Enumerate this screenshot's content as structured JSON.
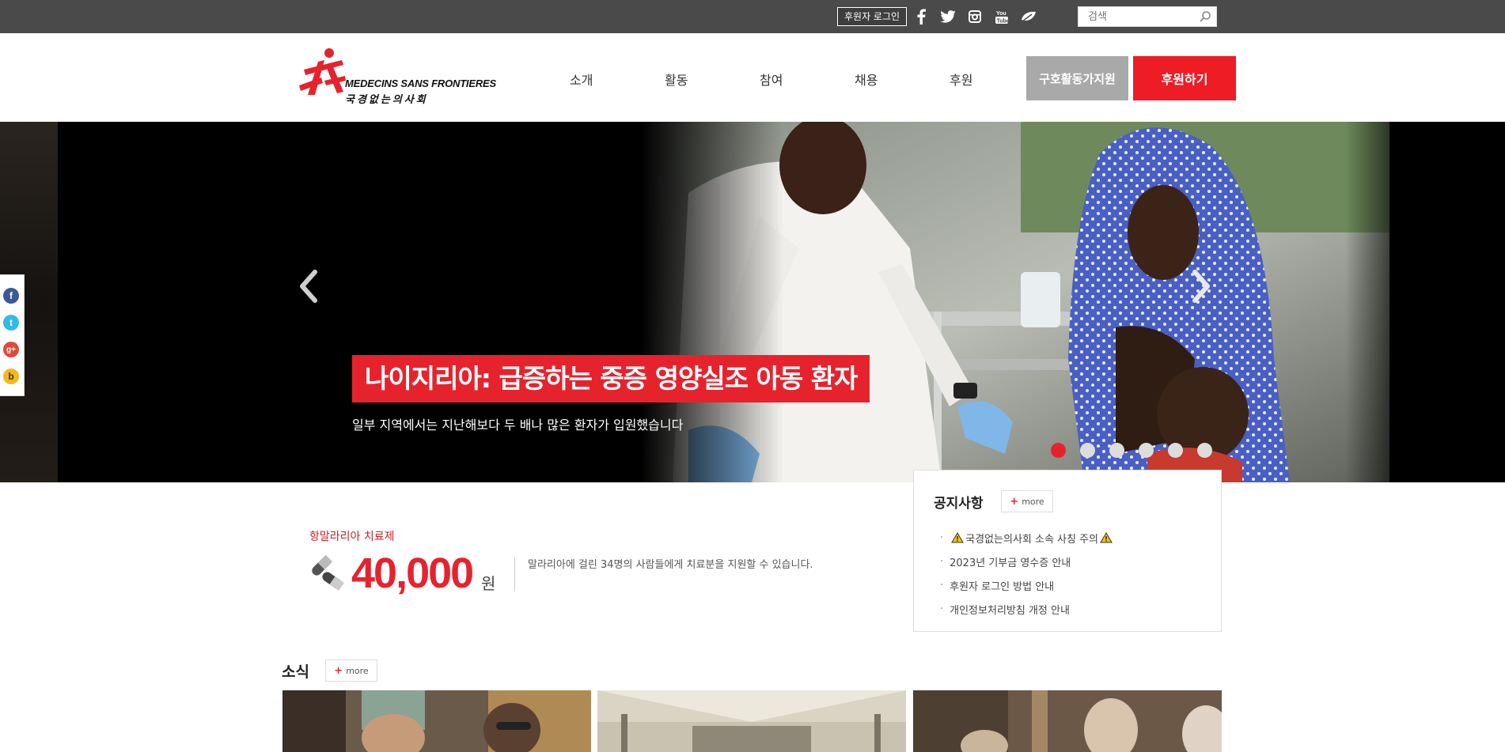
{
  "topbar": {
    "login_label": "후원자 로그인",
    "social": [
      "facebook-icon",
      "twitter-icon",
      "instagram-icon",
      "youtube-icon",
      "leaf-icon"
    ],
    "search_placeholder": "검색"
  },
  "header": {
    "logo_en": "MEDECINS SANS FRONTIERES",
    "logo_ko": "국경없는의사회",
    "nav": [
      "소개",
      "활동",
      "참여",
      "채용",
      "후원"
    ],
    "relief_button": "구호활동가지원",
    "donate_button": "후원하기"
  },
  "hero": {
    "title": "나이지리아: 급증하는 중증 영양실조 아동 환자",
    "subtitle": "일부 지역에서는 지난해보다 두 배나 많은 환자가 입원했습니다",
    "slide_count": 6,
    "active_slide": 1
  },
  "share_float": [
    "facebook",
    "twitter",
    "google-plus",
    "kakao"
  ],
  "notice": {
    "title": "공지사항",
    "more": "more",
    "items": [
      "국경없는의사회 소속 사칭 주의",
      "2023년 기부금 영수증 안내",
      "후원자 로그인 방법 안내",
      "개인정보처리방침 개정 안내"
    ]
  },
  "donation": {
    "label": "항말라리아 치료제",
    "amount": "40,000",
    "unit": "원",
    "description": "말라리아에 걸린 34명의 사람들에게 치료분을 지원할 수 있습니다."
  },
  "news": {
    "title": "소식",
    "more": "more"
  },
  "colors": {
    "brand_red": "#e6232d",
    "topbar": "#4a4a4a",
    "relief_grey": "#a9a9a9"
  }
}
